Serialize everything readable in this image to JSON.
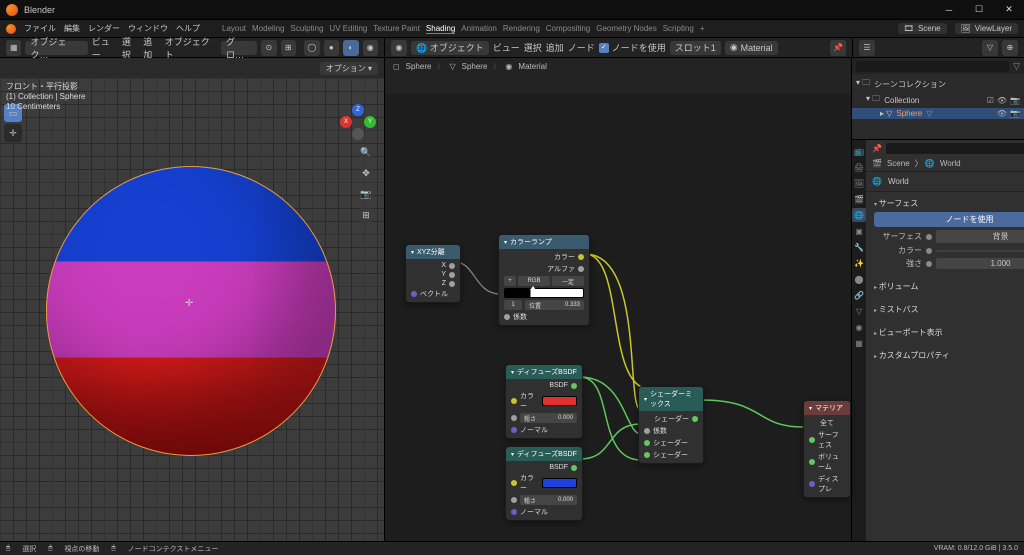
{
  "window": {
    "title": "Blender"
  },
  "menu": {
    "items": [
      "ファイル",
      "編集",
      "レンダー",
      "ウィンドウ",
      "ヘルプ"
    ]
  },
  "workspaces": {
    "items": [
      "Layout",
      "Modeling",
      "Sculpting",
      "UV Editing",
      "Texture Paint",
      "Shading",
      "Animation",
      "Rendering",
      "Compositing",
      "Geometry Nodes",
      "Scripting"
    ],
    "active": "Shading"
  },
  "scene": {
    "label": "Scene",
    "layer": "ViewLayer"
  },
  "toolbar_left": {
    "mode": "オブジェク…",
    "menus": [
      "ビュー",
      "選択",
      "追加",
      "オブジェクト"
    ],
    "global": "グロ…"
  },
  "toolbar_right": {
    "menus": [
      "ビュー",
      "選択",
      "追加",
      "ノード"
    ],
    "use_nodes": "ノードを使用",
    "slot": "スロット1",
    "material": "Material"
  },
  "viewport": {
    "options": "オプション",
    "info": [
      "フロント・平行投影",
      "(1) Collection | Sphere",
      "10 Centimeters"
    ]
  },
  "node_editor": {
    "header_icon": "⬤",
    "breadcrumbs": [
      "Sphere",
      "Sphere",
      "Material"
    ],
    "nodes": {
      "sepxyz": {
        "title": "XYZ分離",
        "outputs": [
          "X",
          "Y",
          "Z"
        ],
        "input": "ベクトル"
      },
      "colorramp": {
        "title": "カラーランプ",
        "outputs": [
          "カラー",
          "アルファ"
        ],
        "mode": "RGB",
        "interp": "一定",
        "pos_lbl": "位置",
        "pos_val": "0.333",
        "stop": "1",
        "input": "係数"
      },
      "diff1": {
        "title": "ディフューズBSDF",
        "out": "BSDF",
        "color": "カラー",
        "rough": "粗さ",
        "rough_val": "0.000",
        "normal": "ノーマル",
        "swatch": "#e13030"
      },
      "diff2": {
        "title": "ディフューズBSDF",
        "out": "BSDF",
        "color": "カラー",
        "rough": "粗さ",
        "rough_val": "0.000",
        "normal": "ノーマル",
        "swatch": "#2040e0"
      },
      "mix": {
        "title": "シェーダーミックス",
        "out": "シェーダー",
        "fac": "係数",
        "s1": "シェーダー",
        "s2": "シェーダー"
      },
      "output": {
        "title": "マテリア",
        "all": "全て",
        "surf": "サーフェス",
        "vol": "ボリューム",
        "disp": "ディスプレ"
      }
    }
  },
  "outliner": {
    "root": "シーンコレクション",
    "collection": "Collection",
    "object": "Sphere"
  },
  "properties": {
    "breadcrumb": [
      "Scene",
      "World"
    ],
    "material": "World",
    "surface": {
      "title": "サーフェス",
      "button": "ノードを使用",
      "surface_lbl": "サーフェス",
      "surface_val": "背景",
      "color_lbl": "カラー",
      "strength_lbl": "強さ",
      "strength_val": "1.000"
    },
    "panels": [
      "ボリューム",
      "ミストパス",
      "ビューポート表示",
      "カスタムプロパティ"
    ]
  },
  "footer": {
    "left": [
      "選択",
      "視点の移動",
      "ノードコンテクストメニュー"
    ],
    "right": "VRAM: 0.8/12.0 GiB | 3.5.0"
  }
}
